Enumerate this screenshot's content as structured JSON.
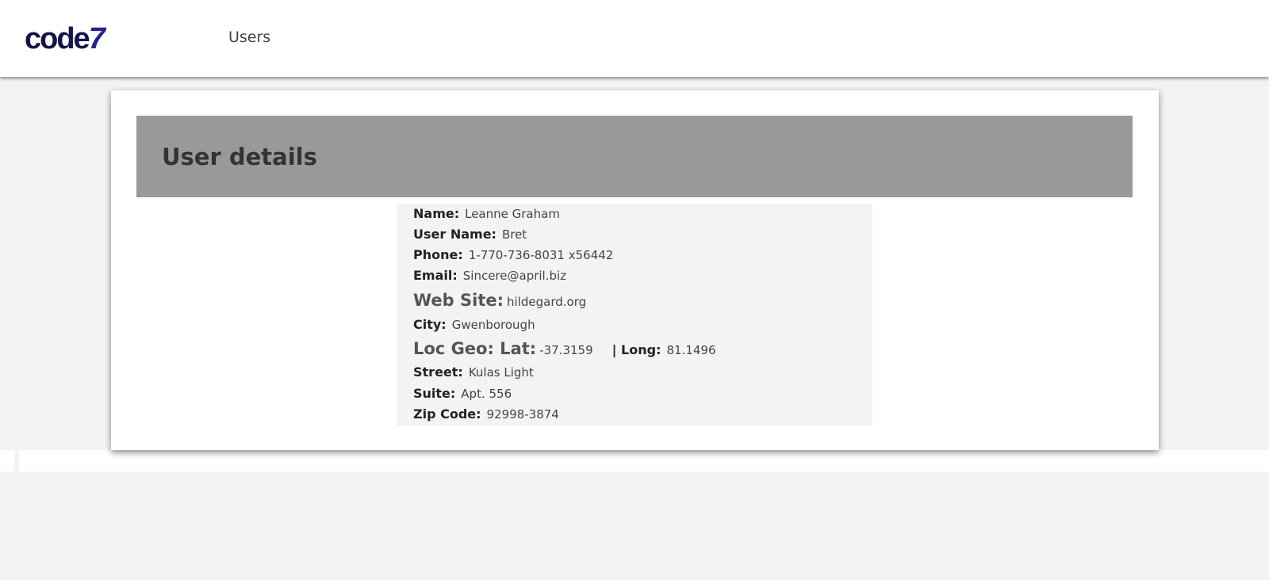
{
  "header": {
    "logo_main": "code",
    "logo_accent": "7",
    "nav": {
      "users_label": "Users"
    }
  },
  "card": {
    "title": "User details",
    "details": {
      "name_label": "Name:",
      "name": "Leanne Graham",
      "username_label": "User Name:",
      "username": "Bret",
      "phone_label": "Phone:",
      "phone": "1-770-736-8031 x56442",
      "email_label": "Email:",
      "email": "Sincere@april.biz",
      "website_label": "Web Site:",
      "website": "hildegard.org",
      "city_label": "City:",
      "city": "Gwenborough",
      "geo_lat_label": "Loc Geo: Lat:",
      "geo_lat": "-37.3159",
      "geo_long_label": "| Long:",
      "geo_long": "81.1496",
      "street_label": "Street:",
      "street": "Kulas Light",
      "suite_label": "Suite:",
      "suite": "Apt. 556",
      "zipcode_label": "Zip Code:",
      "zipcode": "92998-3874"
    }
  },
  "colors": {
    "page_background": "#f3f3f5",
    "header_background": "#ffffff",
    "card_header_background": "#999999",
    "logo": "#15134a",
    "details_background": "#f3f3f5"
  }
}
